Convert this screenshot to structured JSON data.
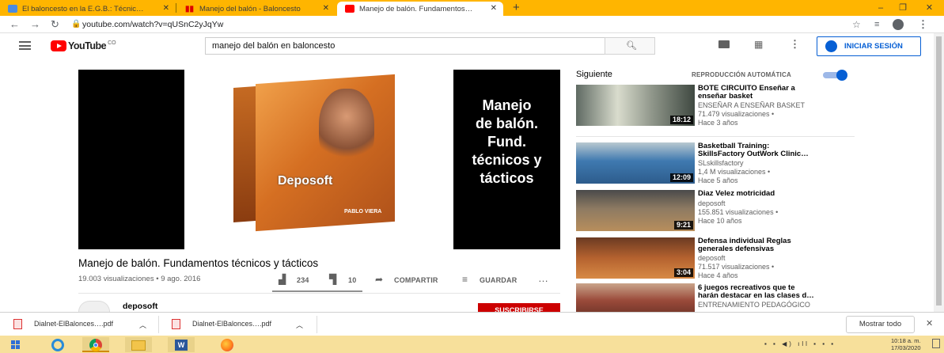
{
  "tabs": [
    {
      "title": "El baloncesto en la E.G.B.: Técnic…",
      "active": false
    },
    {
      "title": "Manejo del balón - Baloncesto",
      "active": false
    },
    {
      "title": "Manejo de balón. Fundamentos…",
      "active": true
    }
  ],
  "address": {
    "url": "youtube.com/watch?v=qUSnC2yJqYw"
  },
  "masthead": {
    "logo_text": "YouTube",
    "country": "CO",
    "search_value": "manejo del balón en baloncesto",
    "signin_label": "INICIAR SESIÓN"
  },
  "player": {
    "overlay_lines": [
      "Manejo",
      "de balón.",
      "Fund.",
      "técnicos y",
      "tácticos"
    ],
    "box_brand": "Deposoft",
    "box_author": "PABLO VIERA"
  },
  "video": {
    "title": "Manejo de balón. Fundamentos técnicos y tácticos",
    "views_date": "19.003 visualizaciones • 9 ago. 2016",
    "likes": "234",
    "dislikes": "10",
    "share_label": "COMPARTIR",
    "save_label": "GUARDAR",
    "more": "…",
    "channel": "deposoft",
    "subscribe_label": "SUSCRIBIRSE"
  },
  "sidebar": {
    "next_label": "Siguiente",
    "autoplay_label": "REPRODUCCIÓN AUTOMÁTICA",
    "autoplay_on": true,
    "items": [
      {
        "title_1": "BOTE CIRCUITO Enseñar a",
        "title_2": "enseñar basket",
        "channel": "ENSEÑAR A ENSEÑAR BASKET",
        "views": "71.479 visualizaciones •",
        "age": "Hace 3 años",
        "duration": "18:12"
      },
      {
        "title_1": "Basketball Training:",
        "title_2": "SkillsFactory OutWork Clinic…",
        "channel": "SLskillsfactory",
        "views": "1,4 M visualizaciones •",
        "age": "Hace 5 años",
        "duration": "12:09"
      },
      {
        "title_1": "Diaz Velez motricidad",
        "title_2": "",
        "channel": "deposoft",
        "views": "155.851 visualizaciones •",
        "age": "Hace 10 años",
        "duration": "9:21"
      },
      {
        "title_1": "Defensa individual Reglas",
        "title_2": "generales defensivas",
        "channel": "deposoft",
        "views": "71.517 visualizaciones •",
        "age": "Hace 4 años",
        "duration": "3:04"
      },
      {
        "title_1": "6 juegos recreativos que te",
        "title_2": "harán destacar en las clases d…",
        "channel": "ENTRENAMIENTO PEDAGÓGICO",
        "views": "",
        "age": "",
        "duration": ""
      }
    ]
  },
  "downloads": {
    "files": [
      "Dialnet-ElBalonces….pdf",
      "Dialnet-ElBalonces….pdf"
    ],
    "show_all": "Mostrar todo"
  },
  "taskbar": {
    "time": "10:18 a. m.",
    "date": "17/03/2020"
  },
  "colors": {
    "tab_strip": "#ffb500",
    "youtube_red": "#ff0000",
    "accent_blue": "#065fd4",
    "subscribe_red": "#cc0000",
    "taskbar": "#f7e09b"
  }
}
